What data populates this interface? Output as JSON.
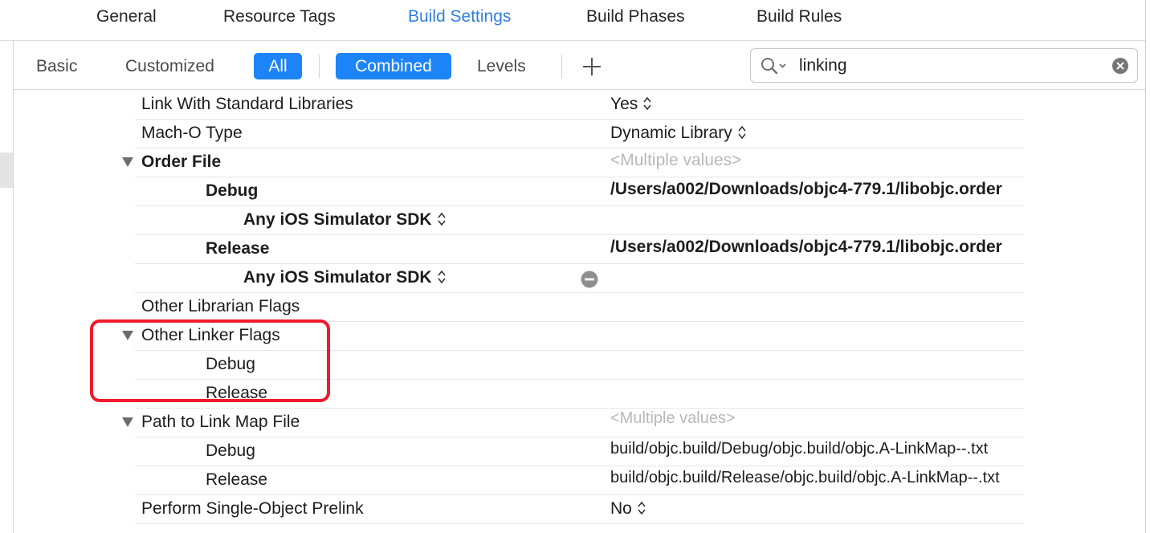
{
  "top_tabs": [
    {
      "label": "General"
    },
    {
      "label": "Resource Tags"
    },
    {
      "label": "Build Settings"
    },
    {
      "label": "Build Phases"
    },
    {
      "label": "Build Rules"
    }
  ],
  "filter_bar": {
    "basic": "Basic",
    "customized": "Customized",
    "all": "All",
    "combined": "Combined",
    "levels": "Levels",
    "add_icon": "plus-icon"
  },
  "search": {
    "value": "linking",
    "search_icon": "magnifier-icon",
    "clear_icon": "clear-icon"
  },
  "colors": {
    "accent": "#1c84f7",
    "active_tab": "#2f7fe0",
    "highlight": "#ef1b2a",
    "muted_text": "#b8b8b8"
  },
  "settings": [
    {
      "name": "Link With Standard Libraries",
      "value": "Yes",
      "stepper": true
    },
    {
      "name": "Mach-O Type",
      "value": "Dynamic Library",
      "stepper": true
    },
    {
      "name": "Order File",
      "value": "<Multiple values>",
      "expanded": true
    },
    {
      "name": "Debug",
      "value": "/Users/a002/Downloads/objc4-779.1/libobjc.order"
    },
    {
      "name": "Any iOS Simulator SDK",
      "value": ""
    },
    {
      "name": "Release",
      "value": "/Users/a002/Downloads/objc4-779.1/libobjc.order"
    },
    {
      "name": "Any iOS Simulator SDK",
      "value": "",
      "minus_icon": "remove-icon"
    },
    {
      "name": "Other Librarian Flags",
      "value": ""
    },
    {
      "name": "Other Linker Flags",
      "value": "",
      "expanded": true,
      "highlighted": true
    },
    {
      "name": "Debug",
      "value": ""
    },
    {
      "name": "Release",
      "value": ""
    },
    {
      "name": "Path to Link Map File",
      "value": "<Multiple values>",
      "expanded": true
    },
    {
      "name": "Debug",
      "value": "build/objc.build/Debug/objc.build/objc.A-LinkMap--.txt"
    },
    {
      "name": "Release",
      "value": "build/objc.build/Release/objc.build/objc.A-LinkMap--.txt"
    },
    {
      "name": "Perform Single-Object Prelink",
      "value": "No",
      "stepper": true
    }
  ]
}
